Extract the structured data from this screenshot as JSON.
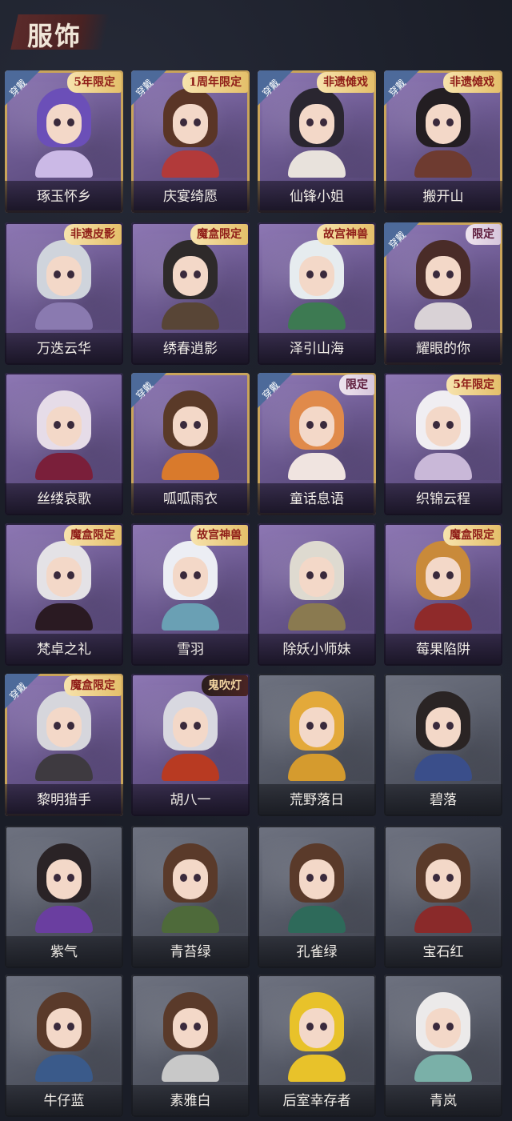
{
  "page_title": "服饰",
  "wear_label": "穿戴",
  "rows": [
    [
      {
        "name": "琢玉怀乡",
        "badge": "5年限定",
        "wearing": true,
        "theme": "purple",
        "hair": "#6b4fb8",
        "body": "#cbb9e6"
      },
      {
        "name": "庆宴绮愿",
        "badge": "1周年限定",
        "wearing": true,
        "theme": "purple",
        "hair": "#5a3526",
        "body": "#b23a3a"
      },
      {
        "name": "仙锋小姐",
        "badge": "非遗傩戏",
        "wearing": true,
        "theme": "purple",
        "hair": "#2a2630",
        "body": "#e8e2dc"
      },
      {
        "name": "搬开山",
        "badge": "非遗傩戏",
        "wearing": true,
        "theme": "purple",
        "hair": "#231e22",
        "body": "#6e3b30"
      }
    ],
    [
      {
        "name": "万迭云华",
        "badge": "非遗皮影",
        "wearing": false,
        "theme": "purple",
        "hair": "#cfd4dc",
        "body": "#8a7ab0"
      },
      {
        "name": "绣春逍影",
        "badge": "魔盒限定",
        "wearing": false,
        "theme": "purple",
        "hair": "#2e2a2a",
        "body": "#584536"
      },
      {
        "name": "泽引山海",
        "badge": "故宫神兽",
        "wearing": false,
        "theme": "purple",
        "hair": "#e6ecef",
        "body": "#3d7a52"
      },
      {
        "name": "耀眼的你",
        "badge": "限定",
        "wearing": true,
        "theme": "purple",
        "hair": "#4a2c28",
        "body": "#d9d2d6"
      }
    ],
    [
      {
        "name": "丝缕哀歌",
        "badge": "",
        "wearing": false,
        "theme": "purple",
        "hair": "#e6dce8",
        "body": "#7a1f3a"
      },
      {
        "name": "呱呱雨衣",
        "badge": "",
        "wearing": true,
        "theme": "purple",
        "hair": "#5a3a28",
        "body": "#d97a2c"
      },
      {
        "name": "童话息语",
        "badge": "限定",
        "wearing": true,
        "theme": "purple",
        "hair": "#e08a4a",
        "body": "#f0e4e0"
      },
      {
        "name": "织锦云程",
        "badge": "5年限定",
        "wearing": false,
        "theme": "purple",
        "hair": "#f0eef2",
        "body": "#c9b8d8"
      }
    ],
    [
      {
        "name": "梵卓之礼",
        "badge": "魔盒限定",
        "wearing": false,
        "theme": "purple",
        "hair": "#e4e2e6",
        "body": "#2a1a22"
      },
      {
        "name": "雪羽",
        "badge": "故宫神兽",
        "wearing": false,
        "theme": "purple",
        "hair": "#eceef4",
        "body": "#6aa0b4"
      },
      {
        "name": "除妖小师妹",
        "badge": "",
        "wearing": false,
        "theme": "purple",
        "hair": "#dedad0",
        "body": "#8a7a50"
      },
      {
        "name": "莓果陷阱",
        "badge": "魔盒限定",
        "wearing": false,
        "theme": "purple",
        "hair": "#c98a3a",
        "body": "#8f2a2a"
      }
    ],
    [
      {
        "name": "黎明猎手",
        "badge": "魔盒限定",
        "wearing": true,
        "theme": "purple",
        "hair": "#d6d6dc",
        "body": "#3e3a40"
      },
      {
        "name": "胡八一",
        "badge": "鬼吹灯",
        "wearing": false,
        "theme": "purple",
        "hair": "#d8d8e0",
        "body": "#b83a22"
      },
      {
        "name": "荒野落日",
        "badge": "",
        "wearing": false,
        "theme": "gray",
        "hair": "#e3a93a",
        "body": "#d59b2e"
      },
      {
        "name": "碧落",
        "badge": "",
        "wearing": false,
        "theme": "gray",
        "hair": "#2a2424",
        "body": "#3a4e8a"
      }
    ],
    [
      {
        "name": "紫气",
        "badge": "",
        "wearing": false,
        "theme": "gray",
        "hair": "#2a2326",
        "body": "#6a3ea0"
      },
      {
        "name": "青苔绿",
        "badge": "",
        "wearing": false,
        "theme": "gray",
        "hair": "#5a3a2a",
        "body": "#4e6a3a"
      },
      {
        "name": "孔雀绿",
        "badge": "",
        "wearing": false,
        "theme": "gray",
        "hair": "#5a3a2a",
        "body": "#2e6a5a"
      },
      {
        "name": "宝石红",
        "badge": "",
        "wearing": false,
        "theme": "gray",
        "hair": "#5a3a2a",
        "body": "#8a2a2a"
      }
    ],
    [
      {
        "name": "牛仔蓝",
        "badge": "",
        "wearing": false,
        "theme": "gray",
        "hair": "#5a3a2a",
        "body": "#3a5a8a"
      },
      {
        "name": "素雅白",
        "badge": "",
        "wearing": false,
        "theme": "gray",
        "hair": "#5a3a2a",
        "body": "#c8c8c8"
      },
      {
        "name": "后室幸存者",
        "badge": "",
        "wearing": false,
        "theme": "gray",
        "hair": "#e8c22a",
        "body": "#e8c22a"
      },
      {
        "name": "青岚",
        "badge": "",
        "wearing": false,
        "theme": "gray",
        "hair": "#eceaea",
        "body": "#7ab0a8"
      }
    ]
  ]
}
